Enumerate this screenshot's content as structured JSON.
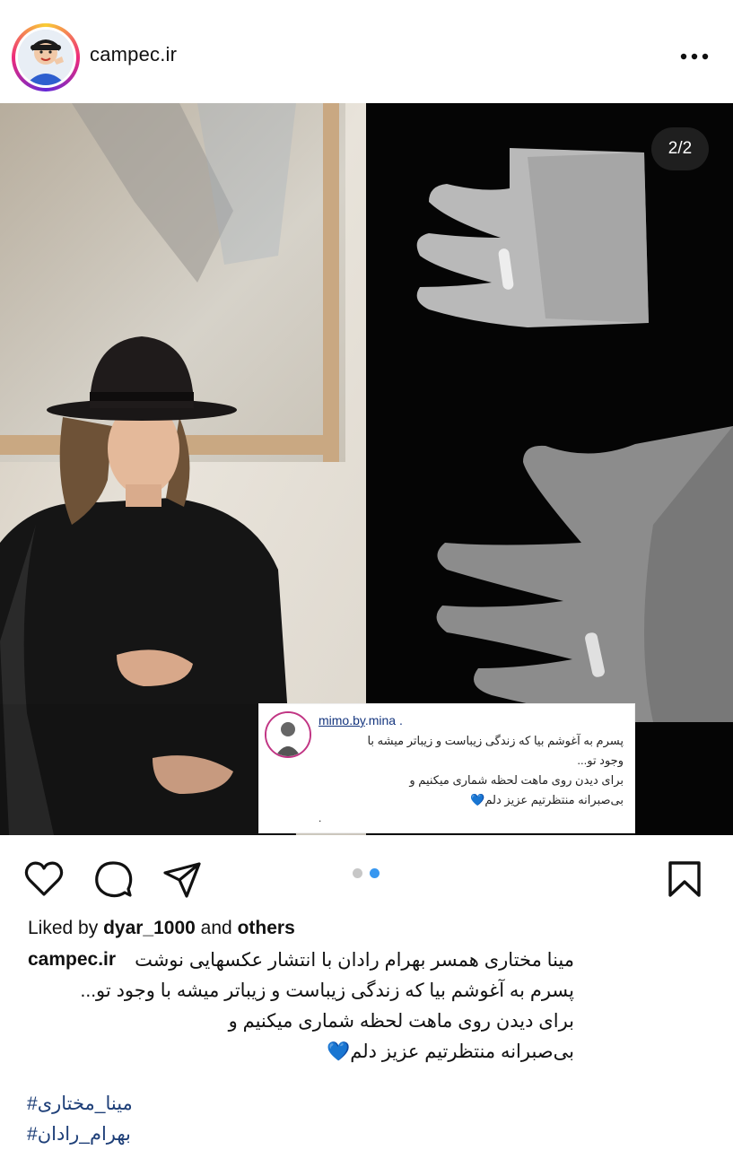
{
  "post": {
    "username": "campec.ir",
    "counter": "2/2",
    "liked_by_prefix": "Liked by",
    "liked_by_user": "dyar_1000",
    "liked_by_and": "and",
    "liked_by_others": "others",
    "caption_line1": "مینا مختاری همسر بهرام رادان با انتشار عکسهایی نوشت",
    "caption_line2": "پسرم به آغوشم بیا که زندگی زیباست و زیباتر میشه با وجود تو...",
    "caption_line3": "برای دیدن روی ماهت لحظه شماری میکنیم و",
    "caption_line4": "بی‌صبرانه منتظرتیم عزیز دلم💙",
    "hashtag1": "#مینا_مختاری",
    "hashtag2": "#بهرام_رادان",
    "active_page": 2,
    "total_pages": 2
  },
  "overlay_comment": {
    "username_link": "mimo.by",
    "username_rest": ".mina .",
    "line1": "پسرم به آغوشم بیا که زندگی زیباست و زیباتر میشه با",
    "line2": "وجود تو...",
    "line3": "برای دیدن روی ماهت لحظه شماری میکنیم و",
    "line4": "بی‌صبرانه منتظرتیم عزیز دلم💙",
    "footer": "."
  },
  "icons": {
    "more": "more-horizontal-icon",
    "like": "heart-icon",
    "comment": "comment-bubble-icon",
    "share": "paper-plane-icon",
    "save": "bookmark-icon"
  },
  "colors": {
    "accent_blue": "#3797f0",
    "hashtag": "#1e3f78",
    "dot_inactive": "#c7c7c7"
  }
}
